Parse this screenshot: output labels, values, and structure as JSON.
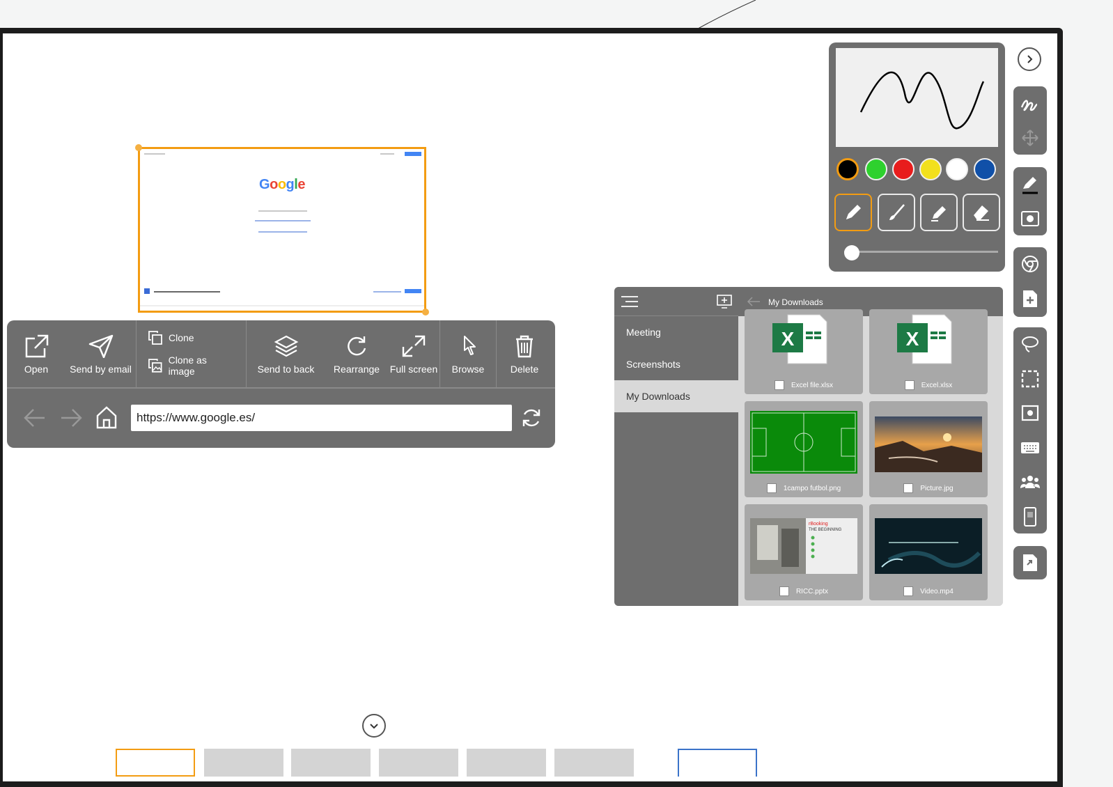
{
  "toolbar": {
    "open": "Open",
    "send_email": "Send by email",
    "clone": "Clone",
    "clone_image": "Clone as image",
    "send_back": "Send to back",
    "rearrange": "Rearrange",
    "full_screen": "Full screen",
    "browse": "Browse",
    "delete": "Delete",
    "url": "https://www.google.es/"
  },
  "preview": {
    "logo": [
      "G",
      "o",
      "o",
      "g",
      "l",
      "e"
    ]
  },
  "files": {
    "breadcrumb": "My Downloads",
    "sidebar": [
      "Meeting",
      "Screenshots",
      "My Downloads"
    ],
    "items": [
      {
        "name": "Excel file.xlsx",
        "kind": "excel"
      },
      {
        "name": "Excel.xlsx",
        "kind": "excel"
      },
      {
        "name": "1campo futbol.png",
        "kind": "field"
      },
      {
        "name": "Picture.jpg",
        "kind": "photo"
      },
      {
        "name": "RICC.pptx",
        "kind": "slides"
      },
      {
        "name": "Video.mp4",
        "kind": "video"
      }
    ],
    "slide_title_1": "rBooking",
    "slide_title_2": "THE BEGINNING"
  },
  "pen": {
    "colors": [
      "#000000",
      "#2ed12e",
      "#e81c1c",
      "#f2e01d",
      "#ffffff",
      "#1050a8"
    ],
    "tools": [
      "pencil-icon",
      "brush-icon",
      "highlighter-icon",
      "eraser-icon"
    ],
    "selected_tool": 0,
    "thickness": 0.05
  },
  "accent": "#f39c12"
}
